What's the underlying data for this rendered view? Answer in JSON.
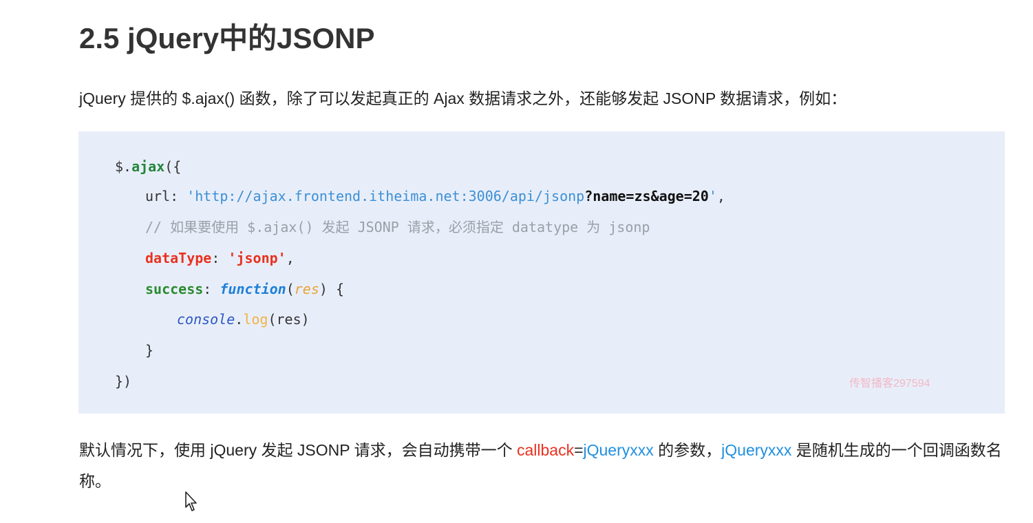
{
  "heading": {
    "title": "2.5 jQuery中的JSONP"
  },
  "intro": {
    "text": "jQuery 提供的 $.ajax() 函数，除了可以发起真正的 Ajax 数据请求之外，还能够发起 JSONP 数据请求，例如："
  },
  "code": {
    "line1": {
      "obj": "$.",
      "method": "ajax",
      "rest": "({"
    },
    "line2": {
      "key": "url: ",
      "quote_open": "'",
      "url": "http://ajax.frontend.itheima.net:3006/api/jsonp",
      "query": "?name=zs&age=20",
      "quote_close": "'",
      "comma": ","
    },
    "line3": {
      "comment": "// 如果要使用 $.ajax() 发起 JSONP 请求，必须指定 datatype 为 jsonp"
    },
    "line4": {
      "key": "dataType",
      "colon": ": ",
      "value": "'jsonp'",
      "comma": ","
    },
    "line5": {
      "key": "success",
      "colon": ": ",
      "fn": "function",
      "paren_open": "(",
      "param": "res",
      "paren_close": ") {"
    },
    "line6": {
      "obj": "console",
      "dot": ".",
      "method": "log",
      "args": "(res)"
    },
    "line7": {
      "text": "}"
    },
    "line8": {
      "text": "})"
    }
  },
  "watermark": {
    "text": "传智播客297594"
  },
  "paragraph": {
    "part1": "默认情况下，使用 jQuery 发起 JSONP 请求，会自动携带一个 ",
    "callback": "callback",
    "equals": "=",
    "jq1": "jQueryxxx",
    "part2": " 的参数，",
    "jq2": "jQueryxxx",
    "part3": " 是随机生成的一个回调函数名称。"
  },
  "colors": {
    "code_background": "#e8eef9",
    "highlight_red": "#e8321f",
    "highlight_blue": "#1f8fe0"
  }
}
